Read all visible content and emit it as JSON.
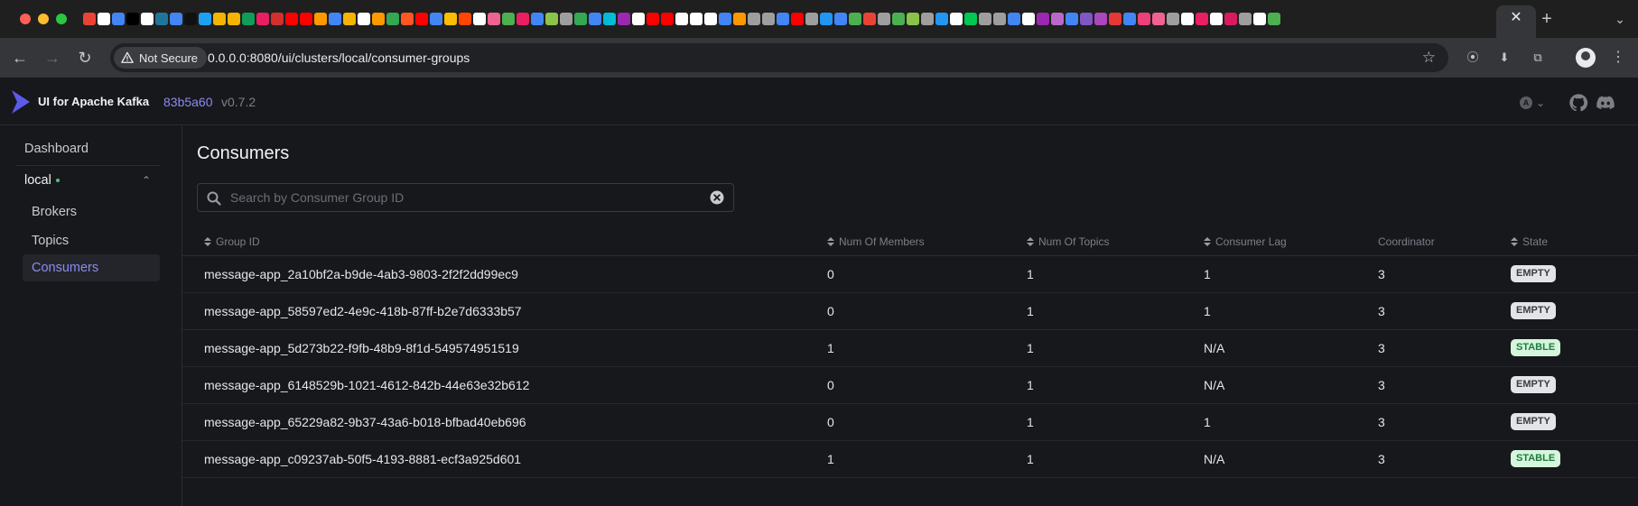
{
  "browser": {
    "active_tab_close": "✕",
    "new_tab": "+",
    "tab_search": "⌄",
    "security_label": "Not Secure",
    "url": "0.0.0.0:8080/ui/clusters/local/consumer-groups",
    "favicon_colors": [
      "#ea4335",
      "#ffffff",
      "#4285f4",
      "#000000",
      "#ffffff",
      "#21759b",
      "#4285f4",
      "#111111",
      "#1da1f2",
      "#f4b400",
      "#f4b400",
      "#0f9d58",
      "#e91e63",
      "#d32f2f",
      "#ff0000",
      "#ff0000",
      "#ff9900",
      "#4285f4",
      "#f4b400",
      "#ffffff",
      "#ff9900",
      "#34a853",
      "#ff5722",
      "#ff0000",
      "#4285f4",
      "#fbbc04",
      "#ff4500",
      "#ffffff",
      "#f06292",
      "#4caf50",
      "#e91e63",
      "#4285f4",
      "#8bc34a",
      "#9e9e9e",
      "#34a853",
      "#4285f4",
      "#00bcd4",
      "#9c27b0",
      "#ffffff",
      "#ff0000",
      "#ff0000",
      "#ffffff",
      "#ffffff",
      "#ffffff",
      "#4285f4",
      "#ff9800",
      "#9e9e9e",
      "#9e9e9e",
      "#4285f4",
      "#ff0000",
      "#9e9e9e",
      "#2196f3",
      "#4285f4",
      "#4caf50",
      "#ea4335",
      "#9e9e9e",
      "#4caf50",
      "#8bc34a",
      "#9e9e9e",
      "#2196f3",
      "#ffffff",
      "#00c853",
      "#9e9e9e",
      "#9e9e9e",
      "#4285f4",
      "#ffffff",
      "#9c27b0",
      "#ba68c8",
      "#4285f4",
      "#7e57c2",
      "#ab47bc",
      "#e53935",
      "#4285f4",
      "#ec407a",
      "#f06292",
      "#9e9e9e",
      "#ffffff",
      "#e91e63",
      "#ffffff",
      "#d81b60",
      "#9e9e9e",
      "#ffffff",
      "#4caf50"
    ]
  },
  "app": {
    "name": "UI for Apache Kafka",
    "version_hash": "83b5a60",
    "version_tag": "v0.7.2",
    "accent_color": "#8b8bf0"
  },
  "sidebar": {
    "dashboard": "Dashboard",
    "cluster": "local",
    "items": [
      {
        "label": "Brokers"
      },
      {
        "label": "Topics"
      },
      {
        "label": "Consumers"
      }
    ]
  },
  "main": {
    "title": "Consumers",
    "search_placeholder": "Search by Consumer Group ID",
    "columns": [
      "Group ID",
      "Num Of Members",
      "Num Of Topics",
      "Consumer Lag",
      "Coordinator",
      "State"
    ],
    "rows": [
      {
        "group_id": "message-app_2a10bf2a-b9de-4ab3-9803-2f2f2dd99ec9",
        "members": "0",
        "topics": "1",
        "lag": "1",
        "coordinator": "3",
        "state": "EMPTY"
      },
      {
        "group_id": "message-app_58597ed2-4e9c-418b-87ff-b2e7d6333b57",
        "members": "0",
        "topics": "1",
        "lag": "1",
        "coordinator": "3",
        "state": "EMPTY"
      },
      {
        "group_id": "message-app_5d273b22-f9fb-48b9-8f1d-549574951519",
        "members": "1",
        "topics": "1",
        "lag": "N/A",
        "coordinator": "3",
        "state": "STABLE"
      },
      {
        "group_id": "message-app_6148529b-1021-4612-842b-44e63e32b612",
        "members": "0",
        "topics": "1",
        "lag": "N/A",
        "coordinator": "3",
        "state": "EMPTY"
      },
      {
        "group_id": "message-app_65229a82-9b37-43a6-b018-bfbad40eb696",
        "members": "0",
        "topics": "1",
        "lag": "1",
        "coordinator": "3",
        "state": "EMPTY"
      },
      {
        "group_id": "message-app_c09237ab-50f5-4193-8881-ecf3a925d601",
        "members": "1",
        "topics": "1",
        "lag": "N/A",
        "coordinator": "3",
        "state": "STABLE"
      }
    ]
  }
}
